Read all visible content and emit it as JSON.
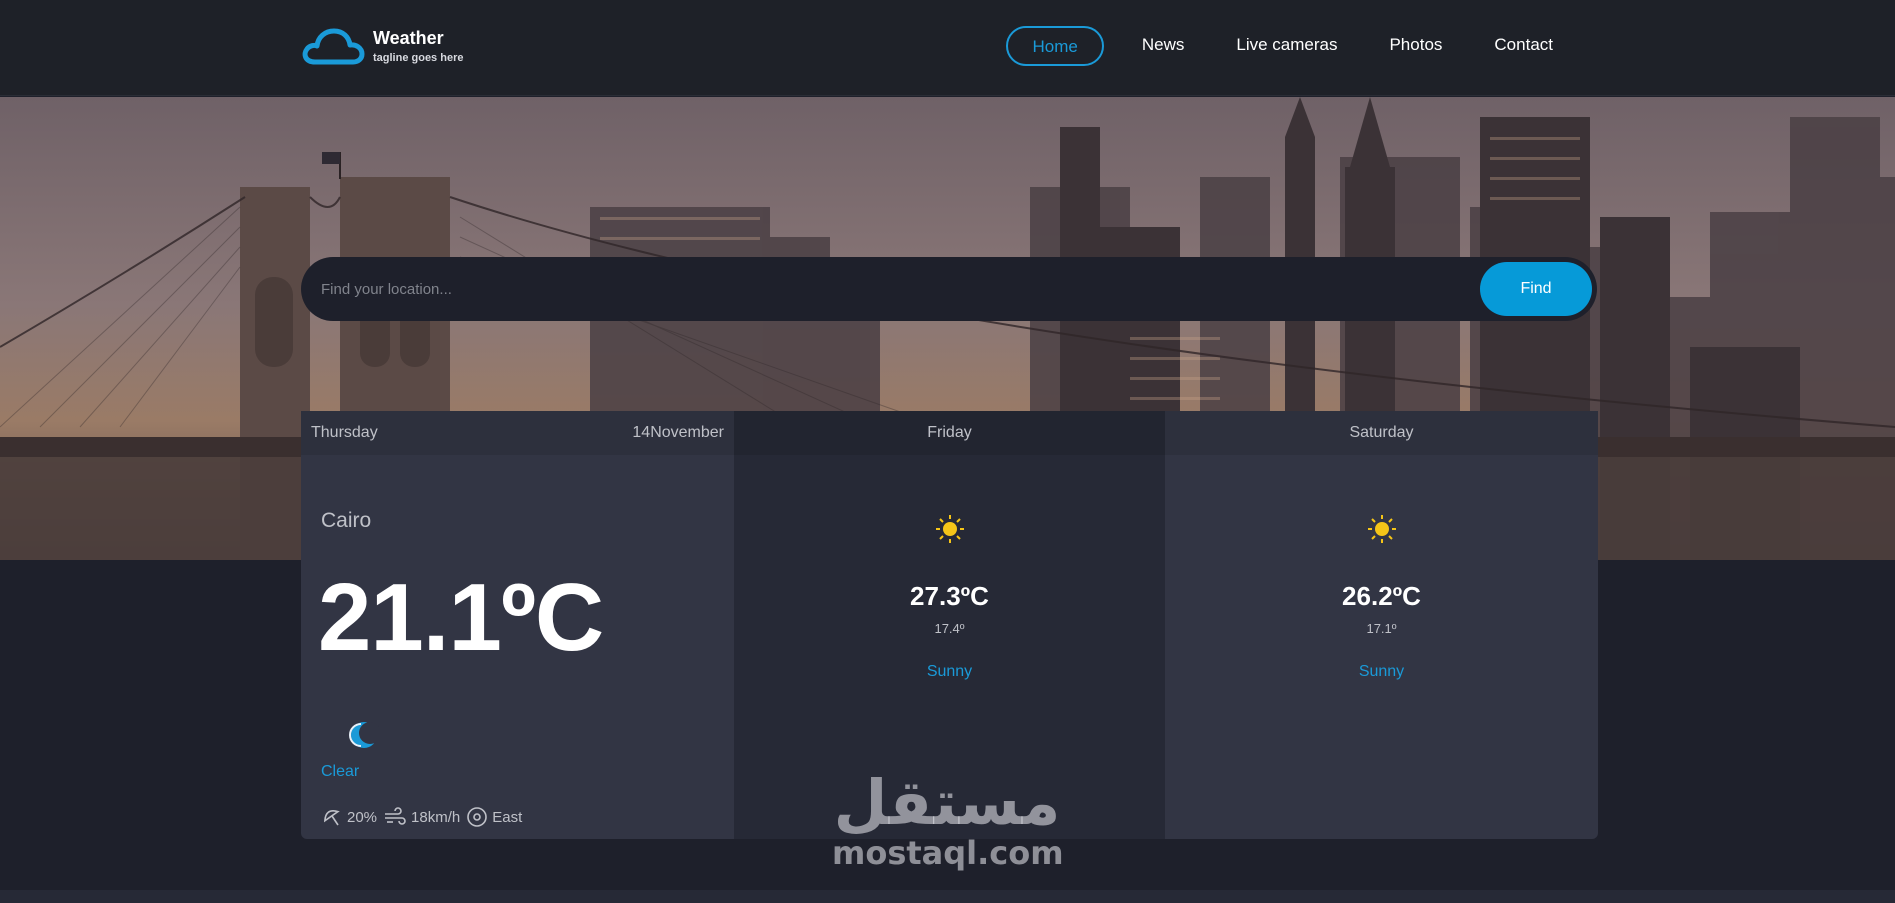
{
  "brand": {
    "title": "Weather",
    "tagline": "tagline goes here",
    "logo_icon": "cloud-icon"
  },
  "nav": {
    "items": [
      {
        "label": "Home",
        "active": true
      },
      {
        "label": "News"
      },
      {
        "label": "Live cameras"
      },
      {
        "label": "Photos"
      },
      {
        "label": "Contact"
      }
    ]
  },
  "search": {
    "placeholder": "Find your location...",
    "button_label": "Find"
  },
  "forecast": {
    "today": {
      "day": "Thursday",
      "date": "14November",
      "city": "Cairo",
      "temperature": "21.1ºC",
      "icon": "moon-icon",
      "condition": "Clear",
      "humidity": "20%",
      "wind_speed": "18km/h",
      "wind_direction": "East"
    },
    "next": [
      {
        "day": "Friday",
        "icon": "sun-icon",
        "high": "27.3ºC",
        "low": "17.4º",
        "condition": "Sunny"
      },
      {
        "day": "Saturday",
        "icon": "sun-icon",
        "high": "26.2ºC",
        "low": "17.1º",
        "condition": "Sunny"
      }
    ]
  },
  "watermark": {
    "arabic": "مستقل",
    "latin": "mostaql.com"
  },
  "colors": {
    "accent": "#069ad8",
    "header_bg": "#1e2128",
    "page_bg": "#1e202b",
    "card_bg": "#323544",
    "card_alt_bg": "#262936"
  }
}
